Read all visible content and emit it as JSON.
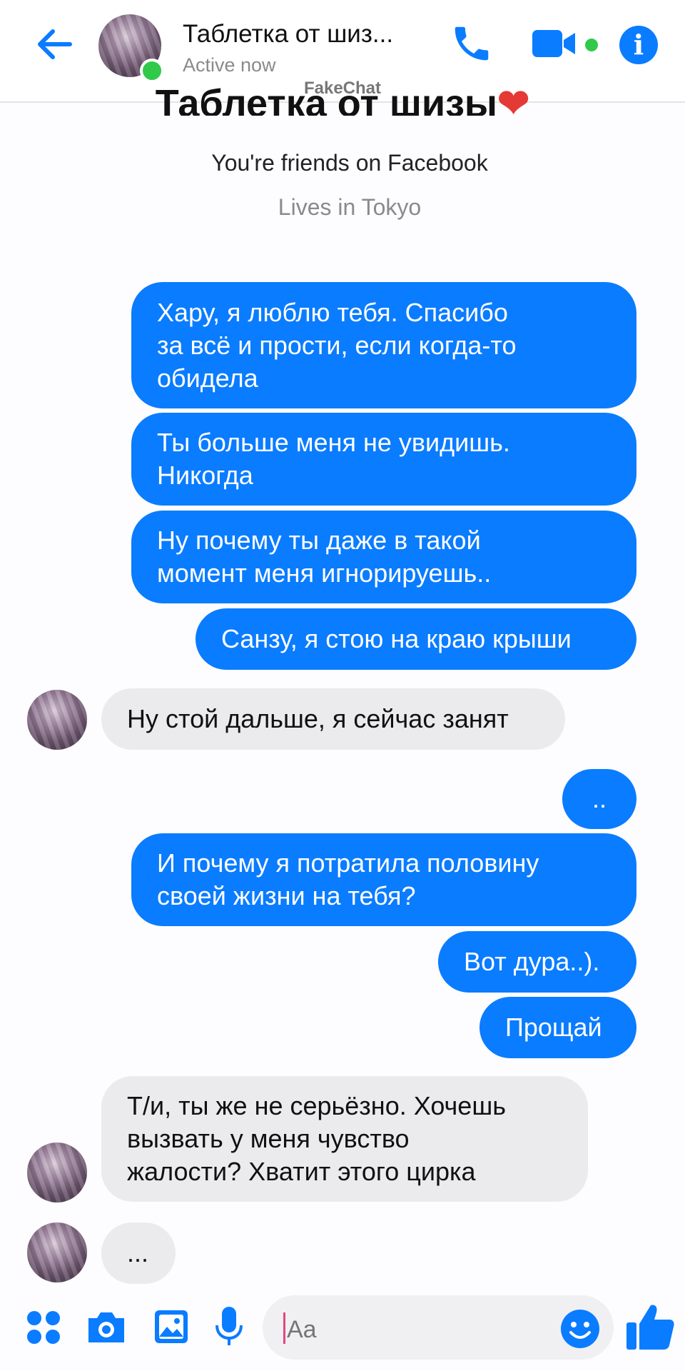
{
  "header": {
    "contact_name": "Таблетка от шиз...",
    "status": "Active now",
    "watermark": "FakeChat"
  },
  "profile": {
    "name": "Таблетка от шизы",
    "heart": "❤",
    "friends_text": "You're friends on Facebook",
    "lives_text": "Lives in Tokyo"
  },
  "messages": [
    {
      "side": "out",
      "lines": [
        "Хару, я люблю тебя. Спасибо",
        "за всё и прости, если когда-то",
        "обидела"
      ]
    },
    {
      "side": "out",
      "lines": [
        "Ты больше меня не увидишь.",
        "Никогда"
      ]
    },
    {
      "side": "out",
      "lines": [
        "Ну почему ты даже в такой",
        "момент меня игнорируешь.."
      ]
    },
    {
      "side": "out",
      "lines": [
        "Санзу, я стою на краю крыши"
      ]
    },
    {
      "side": "in",
      "lines": [
        "Ну стой дальше, я сейчас занят"
      ]
    },
    {
      "side": "out",
      "lines": [
        ".."
      ]
    },
    {
      "side": "out",
      "lines": [
        "И почему я потратила половину",
        "своей жизни на тебя?"
      ]
    },
    {
      "side": "out",
      "lines": [
        "Вот дура..)."
      ]
    },
    {
      "side": "out",
      "lines": [
        "Прощай"
      ]
    },
    {
      "side": "in",
      "lines": [
        "Т/и, ты же не серьёзно. Хочешь",
        "вызвать у меня чувство",
        "жалости? Хватит этого цирка"
      ]
    },
    {
      "side": "in",
      "lines": [
        "..."
      ]
    }
  ],
  "composer": {
    "placeholder": "Aa"
  },
  "icons": {
    "back": "arrow-left-icon",
    "call": "phone-icon",
    "video": "video-camera-icon",
    "info": "info-icon",
    "apps": "four-dots-icon",
    "camera": "camera-icon",
    "gallery": "image-icon",
    "mic": "microphone-icon",
    "emoji": "smiley-icon",
    "like": "thumbs-up-icon"
  },
  "colors": {
    "accent": "#0a7cff",
    "incoming_bubble": "#ebebee",
    "online": "#31c94a"
  }
}
